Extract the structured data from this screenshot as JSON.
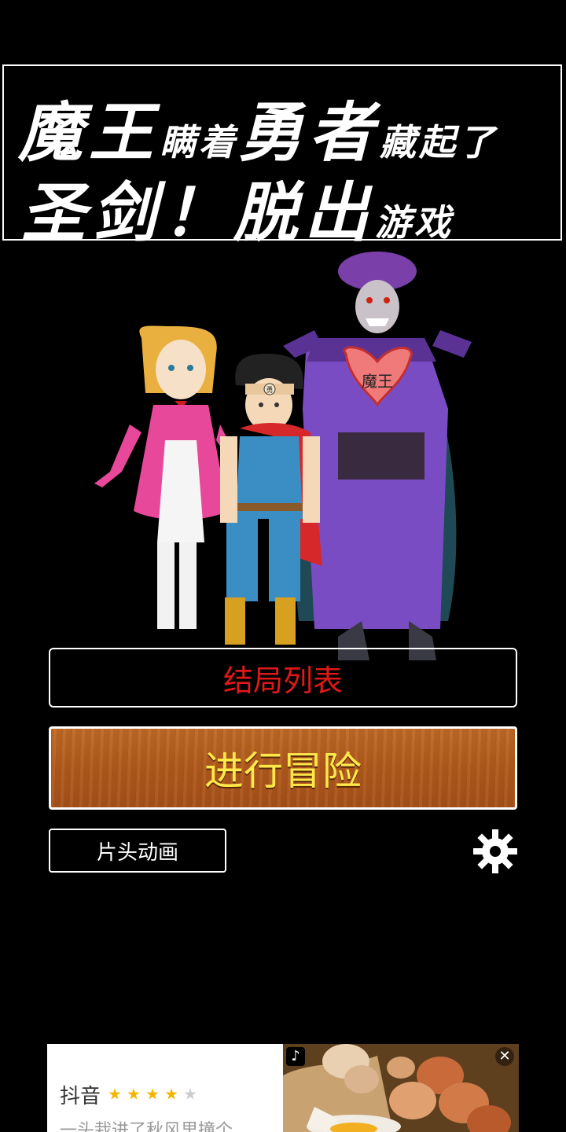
{
  "title": {
    "line1": [
      {
        "text": "魔王",
        "size": "big"
      },
      {
        "text": "瞒着",
        "size": "small"
      },
      {
        "text": "勇者",
        "size": "big"
      },
      {
        "text": "藏起了",
        "size": "small"
      }
    ],
    "line2": [
      {
        "text": "圣剑！脱出",
        "size": "big"
      },
      {
        "text": "游戏",
        "size": "small"
      }
    ]
  },
  "art": {
    "heart_label": "魔王",
    "headband_label": "勇"
  },
  "buttons": {
    "endings_label": "结局列表",
    "adventure_label": "进行冒险",
    "intro_label": "片头动画"
  },
  "settings_icon": "gear-icon",
  "ad": {
    "app_name": "抖音",
    "rating": 4,
    "max_rating": 5,
    "description": "一头栽进了秋风里撞个...",
    "close_symbol": "✕",
    "platform_icon": "tiktok-icon"
  },
  "colors": {
    "endings_text": "#e01818",
    "adventure_text": "#ffe84a",
    "adventure_bg": "#b25a1c",
    "star_on": "#f5b400",
    "star_off": "#cccccc"
  }
}
